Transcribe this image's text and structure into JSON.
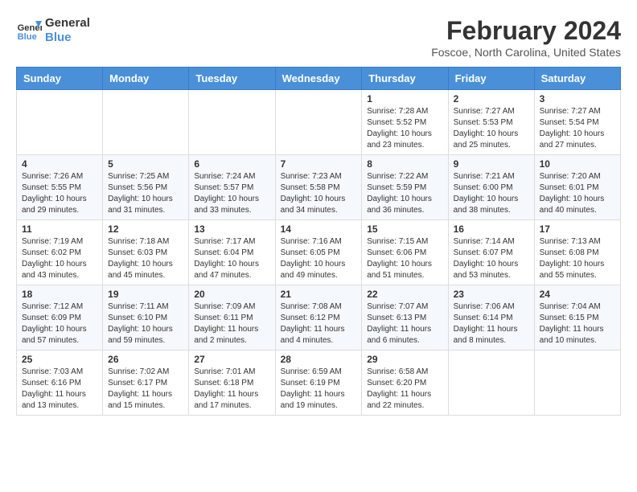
{
  "header": {
    "logo_line1": "General",
    "logo_line2": "Blue",
    "month_year": "February 2024",
    "location": "Foscoe, North Carolina, United States"
  },
  "weekdays": [
    "Sunday",
    "Monday",
    "Tuesday",
    "Wednesday",
    "Thursday",
    "Friday",
    "Saturday"
  ],
  "weeks": [
    [
      {
        "day": "",
        "info": ""
      },
      {
        "day": "",
        "info": ""
      },
      {
        "day": "",
        "info": ""
      },
      {
        "day": "",
        "info": ""
      },
      {
        "day": "1",
        "info": "Sunrise: 7:28 AM\nSunset: 5:52 PM\nDaylight: 10 hours\nand 23 minutes."
      },
      {
        "day": "2",
        "info": "Sunrise: 7:27 AM\nSunset: 5:53 PM\nDaylight: 10 hours\nand 25 minutes."
      },
      {
        "day": "3",
        "info": "Sunrise: 7:27 AM\nSunset: 5:54 PM\nDaylight: 10 hours\nand 27 minutes."
      }
    ],
    [
      {
        "day": "4",
        "info": "Sunrise: 7:26 AM\nSunset: 5:55 PM\nDaylight: 10 hours\nand 29 minutes."
      },
      {
        "day": "5",
        "info": "Sunrise: 7:25 AM\nSunset: 5:56 PM\nDaylight: 10 hours\nand 31 minutes."
      },
      {
        "day": "6",
        "info": "Sunrise: 7:24 AM\nSunset: 5:57 PM\nDaylight: 10 hours\nand 33 minutes."
      },
      {
        "day": "7",
        "info": "Sunrise: 7:23 AM\nSunset: 5:58 PM\nDaylight: 10 hours\nand 34 minutes."
      },
      {
        "day": "8",
        "info": "Sunrise: 7:22 AM\nSunset: 5:59 PM\nDaylight: 10 hours\nand 36 minutes."
      },
      {
        "day": "9",
        "info": "Sunrise: 7:21 AM\nSunset: 6:00 PM\nDaylight: 10 hours\nand 38 minutes."
      },
      {
        "day": "10",
        "info": "Sunrise: 7:20 AM\nSunset: 6:01 PM\nDaylight: 10 hours\nand 40 minutes."
      }
    ],
    [
      {
        "day": "11",
        "info": "Sunrise: 7:19 AM\nSunset: 6:02 PM\nDaylight: 10 hours\nand 43 minutes."
      },
      {
        "day": "12",
        "info": "Sunrise: 7:18 AM\nSunset: 6:03 PM\nDaylight: 10 hours\nand 45 minutes."
      },
      {
        "day": "13",
        "info": "Sunrise: 7:17 AM\nSunset: 6:04 PM\nDaylight: 10 hours\nand 47 minutes."
      },
      {
        "day": "14",
        "info": "Sunrise: 7:16 AM\nSunset: 6:05 PM\nDaylight: 10 hours\nand 49 minutes."
      },
      {
        "day": "15",
        "info": "Sunrise: 7:15 AM\nSunset: 6:06 PM\nDaylight: 10 hours\nand 51 minutes."
      },
      {
        "day": "16",
        "info": "Sunrise: 7:14 AM\nSunset: 6:07 PM\nDaylight: 10 hours\nand 53 minutes."
      },
      {
        "day": "17",
        "info": "Sunrise: 7:13 AM\nSunset: 6:08 PM\nDaylight: 10 hours\nand 55 minutes."
      }
    ],
    [
      {
        "day": "18",
        "info": "Sunrise: 7:12 AM\nSunset: 6:09 PM\nDaylight: 10 hours\nand 57 minutes."
      },
      {
        "day": "19",
        "info": "Sunrise: 7:11 AM\nSunset: 6:10 PM\nDaylight: 10 hours\nand 59 minutes."
      },
      {
        "day": "20",
        "info": "Sunrise: 7:09 AM\nSunset: 6:11 PM\nDaylight: 11 hours\nand 2 minutes."
      },
      {
        "day": "21",
        "info": "Sunrise: 7:08 AM\nSunset: 6:12 PM\nDaylight: 11 hours\nand 4 minutes."
      },
      {
        "day": "22",
        "info": "Sunrise: 7:07 AM\nSunset: 6:13 PM\nDaylight: 11 hours\nand 6 minutes."
      },
      {
        "day": "23",
        "info": "Sunrise: 7:06 AM\nSunset: 6:14 PM\nDaylight: 11 hours\nand 8 minutes."
      },
      {
        "day": "24",
        "info": "Sunrise: 7:04 AM\nSunset: 6:15 PM\nDaylight: 11 hours\nand 10 minutes."
      }
    ],
    [
      {
        "day": "25",
        "info": "Sunrise: 7:03 AM\nSunset: 6:16 PM\nDaylight: 11 hours\nand 13 minutes."
      },
      {
        "day": "26",
        "info": "Sunrise: 7:02 AM\nSunset: 6:17 PM\nDaylight: 11 hours\nand 15 minutes."
      },
      {
        "day": "27",
        "info": "Sunrise: 7:01 AM\nSunset: 6:18 PM\nDaylight: 11 hours\nand 17 minutes."
      },
      {
        "day": "28",
        "info": "Sunrise: 6:59 AM\nSunset: 6:19 PM\nDaylight: 11 hours\nand 19 minutes."
      },
      {
        "day": "29",
        "info": "Sunrise: 6:58 AM\nSunset: 6:20 PM\nDaylight: 11 hours\nand 22 minutes."
      },
      {
        "day": "",
        "info": ""
      },
      {
        "day": "",
        "info": ""
      }
    ]
  ]
}
